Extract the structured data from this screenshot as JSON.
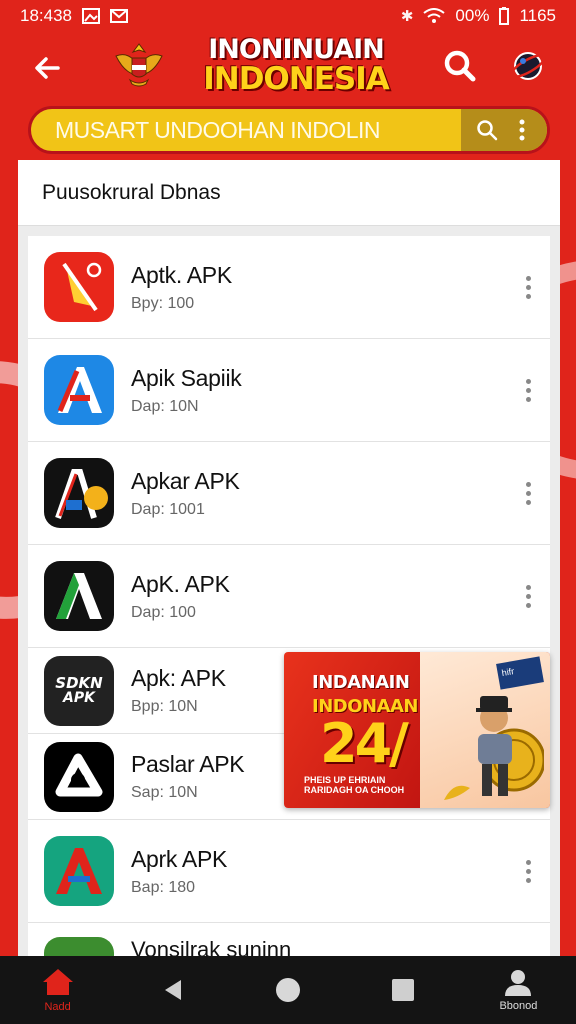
{
  "status_bar": {
    "time": "18:438",
    "battery": "00%",
    "clock_right": "1165"
  },
  "app_bar": {
    "brand_line1": "INONINUAIN",
    "brand_line2": "INDONESIA",
    "icons": [
      "back-arrow-icon",
      "garuda-emblem-icon",
      "search-icon",
      "globe-icon"
    ]
  },
  "search": {
    "placeholder": "MUSART UNDOOHAN INDOLIN"
  },
  "section": {
    "header": "Puusokrural Dbnas"
  },
  "apps": [
    {
      "name": "Aptk. APK",
      "sub": "Bpy: 100",
      "icon": "red-tool-icon",
      "color": "#e8271b"
    },
    {
      "name": "Apik Sapiik",
      "sub": "Dap: 10N",
      "icon": "blue-a-icon",
      "color": "#1976d2"
    },
    {
      "name": "Apkar APK",
      "sub": "Dap: 1001",
      "icon": "black-a-gold-icon",
      "color": "#111111"
    },
    {
      "name": "ApK. APK",
      "sub": "Dap: 100",
      "icon": "green-a-icon",
      "color": "#111111"
    },
    {
      "name": "Apk: APK",
      "sub": "Bpp: 10N",
      "icon": "sdkn-apk-icon",
      "color": "#222222"
    },
    {
      "name": "Paslar APK",
      "sub": "Sap: 10N",
      "icon": "white-logo-icon",
      "color": "#000000"
    },
    {
      "name": "Aprk APK",
      "sub": "Bap: 180",
      "icon": "teal-a-icon",
      "color": "#14a37f"
    },
    {
      "name": "Vonsilrak suninn",
      "sub": "",
      "icon": "green-circle-icon",
      "color": "#3c8d2f"
    }
  ],
  "sdkn_icon_text": [
    "SDKN",
    "APK"
  ],
  "ad": {
    "line1": "INDANAIN",
    "line2": "INDONAAN",
    "number": "24/",
    "small": "PHEIS UP EHRIAIN RARIDAGH OA CHOOH",
    "tag": "hifr"
  },
  "bottom_nav": {
    "items": [
      {
        "label": "Nadd",
        "icon": "home-icon",
        "active": true
      },
      {
        "label": "",
        "icon": "back-triangle-icon",
        "active": false
      },
      {
        "label": "",
        "icon": "circle-icon",
        "active": false
      },
      {
        "label": "",
        "icon": "square-icon",
        "active": false
      },
      {
        "label": "Bbonod",
        "icon": "profile-icon",
        "active": false
      }
    ]
  },
  "colors": {
    "primary_red": "#e0241b",
    "search_yellow": "#f1c417",
    "brand_yellow": "#ffd21a"
  }
}
